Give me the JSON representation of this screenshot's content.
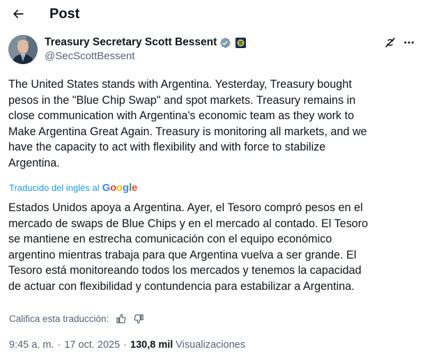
{
  "header": {
    "title": "Post",
    "back_icon": "arrow-left-icon"
  },
  "author": {
    "display_name": "Treasury Secretary Scott Bessent",
    "handle": "@SecScottBessent",
    "verified_badge": "gray-verified-badge-icon",
    "affiliation_icon": "us-treasury-seal-icon",
    "grok_icon": "grok-icon",
    "more_icon": "more-horizontal-icon"
  },
  "tweet": {
    "lines": [
      "The United States stands with Argentina. Yesterday, Treasury bought",
      "pesos in the \"Blue Chip Swap\" and spot markets. Treasury remains in",
      "close communication with Argentina's economic team as they work to",
      "Make Argentina Great Again. Treasury is monitoring all markets, and we",
      "have the capacity to act with flexibility and with force to stabilize",
      "Argentina."
    ]
  },
  "translation": {
    "label": "Traducido del inglés al",
    "provider": "Google",
    "lines": [
      "Estados Unidos apoya a Argentina. Ayer, el Tesoro compró pesos en el",
      "mercado de swaps de Blue Chips y en el mercado al contado. El Tesoro",
      "se mantiene en estrecha comunicación con el equipo económico",
      "argentino mientras trabaja para que Argentina vuelva a ser grande. El",
      "Tesoro está monitoreando todos los mercados y tenemos la capacidad",
      "de actuar con flexibilidad y contundencia para estabilizar a Argentina."
    ],
    "rate_label": "Califica esta traducción:"
  },
  "meta": {
    "time": "9:45 a. m.",
    "separator": "·",
    "date": "17 oct. 2025",
    "views_count": "130,8 mil",
    "views_label": "Visualizaciones"
  },
  "colors": {
    "text": "#0f1419",
    "secondary": "#536471",
    "link": "#1d9bf0",
    "verified_gray": "#829aab"
  }
}
